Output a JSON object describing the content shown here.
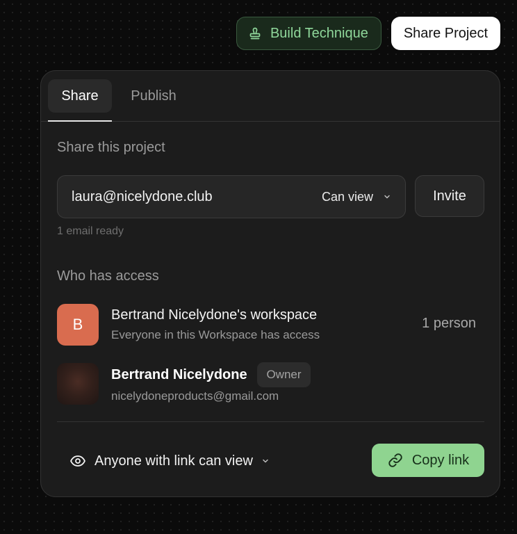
{
  "topbar": {
    "build_technique_label": "Build Technique",
    "share_project_label": "Share Project"
  },
  "tabs": [
    {
      "label": "Share",
      "active": true
    },
    {
      "label": "Publish",
      "active": false
    }
  ],
  "share": {
    "section_title": "Share this project",
    "email_value": "laura@nicelydone.club",
    "permission_selected": "Can view",
    "invite_label": "Invite",
    "email_hint": "1 email ready"
  },
  "access": {
    "section_title": "Who has access",
    "workspace": {
      "avatar_letter": "B",
      "name": "Bertrand Nicelydone's workspace",
      "description": "Everyone in this Workspace has access",
      "count": "1 person"
    },
    "owner": {
      "name": "Bertrand Nicelydone",
      "badge": "Owner",
      "email": "nicelydoneproducts@gmail.com"
    }
  },
  "link": {
    "access_label": "Anyone with link can view",
    "copy_label": "Copy link"
  },
  "colors": {
    "accent_green": "#8fd490",
    "workspace_avatar": "#d96c4f",
    "panel_bg": "#1c1c1c"
  }
}
